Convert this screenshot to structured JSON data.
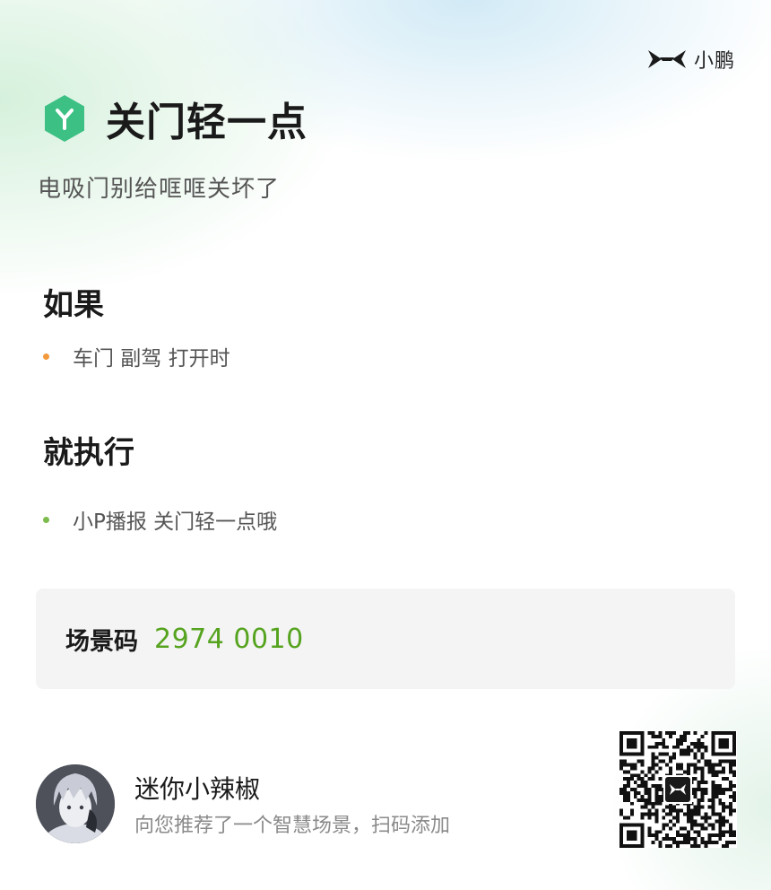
{
  "brand": {
    "name": "小鹏",
    "logo_icon": "xpeng-logo-icon"
  },
  "header": {
    "icon": "hexagon-y-icon",
    "icon_color": "#3cc083",
    "title": "关门轻一点",
    "subtitle": "电吸门别给哐哐关坏了"
  },
  "condition": {
    "title": "如果",
    "items": [
      {
        "text": "车门 副驾 打开时",
        "dot_color": "#f29a3b"
      }
    ]
  },
  "action": {
    "title": "就执行",
    "items": [
      {
        "text": "小P播报 关门轻一点哦",
        "dot_color": "#7dbb4c"
      }
    ]
  },
  "scene_code": {
    "label": "场景码",
    "value": "2974 0010",
    "value_color": "#55a31e"
  },
  "share": {
    "user_name": "迷你小辣椒",
    "text": "向您推荐了一个智慧场景，扫码添加",
    "avatar_icon": "anime-avatar",
    "qr_icon": "qr-code-icon"
  }
}
